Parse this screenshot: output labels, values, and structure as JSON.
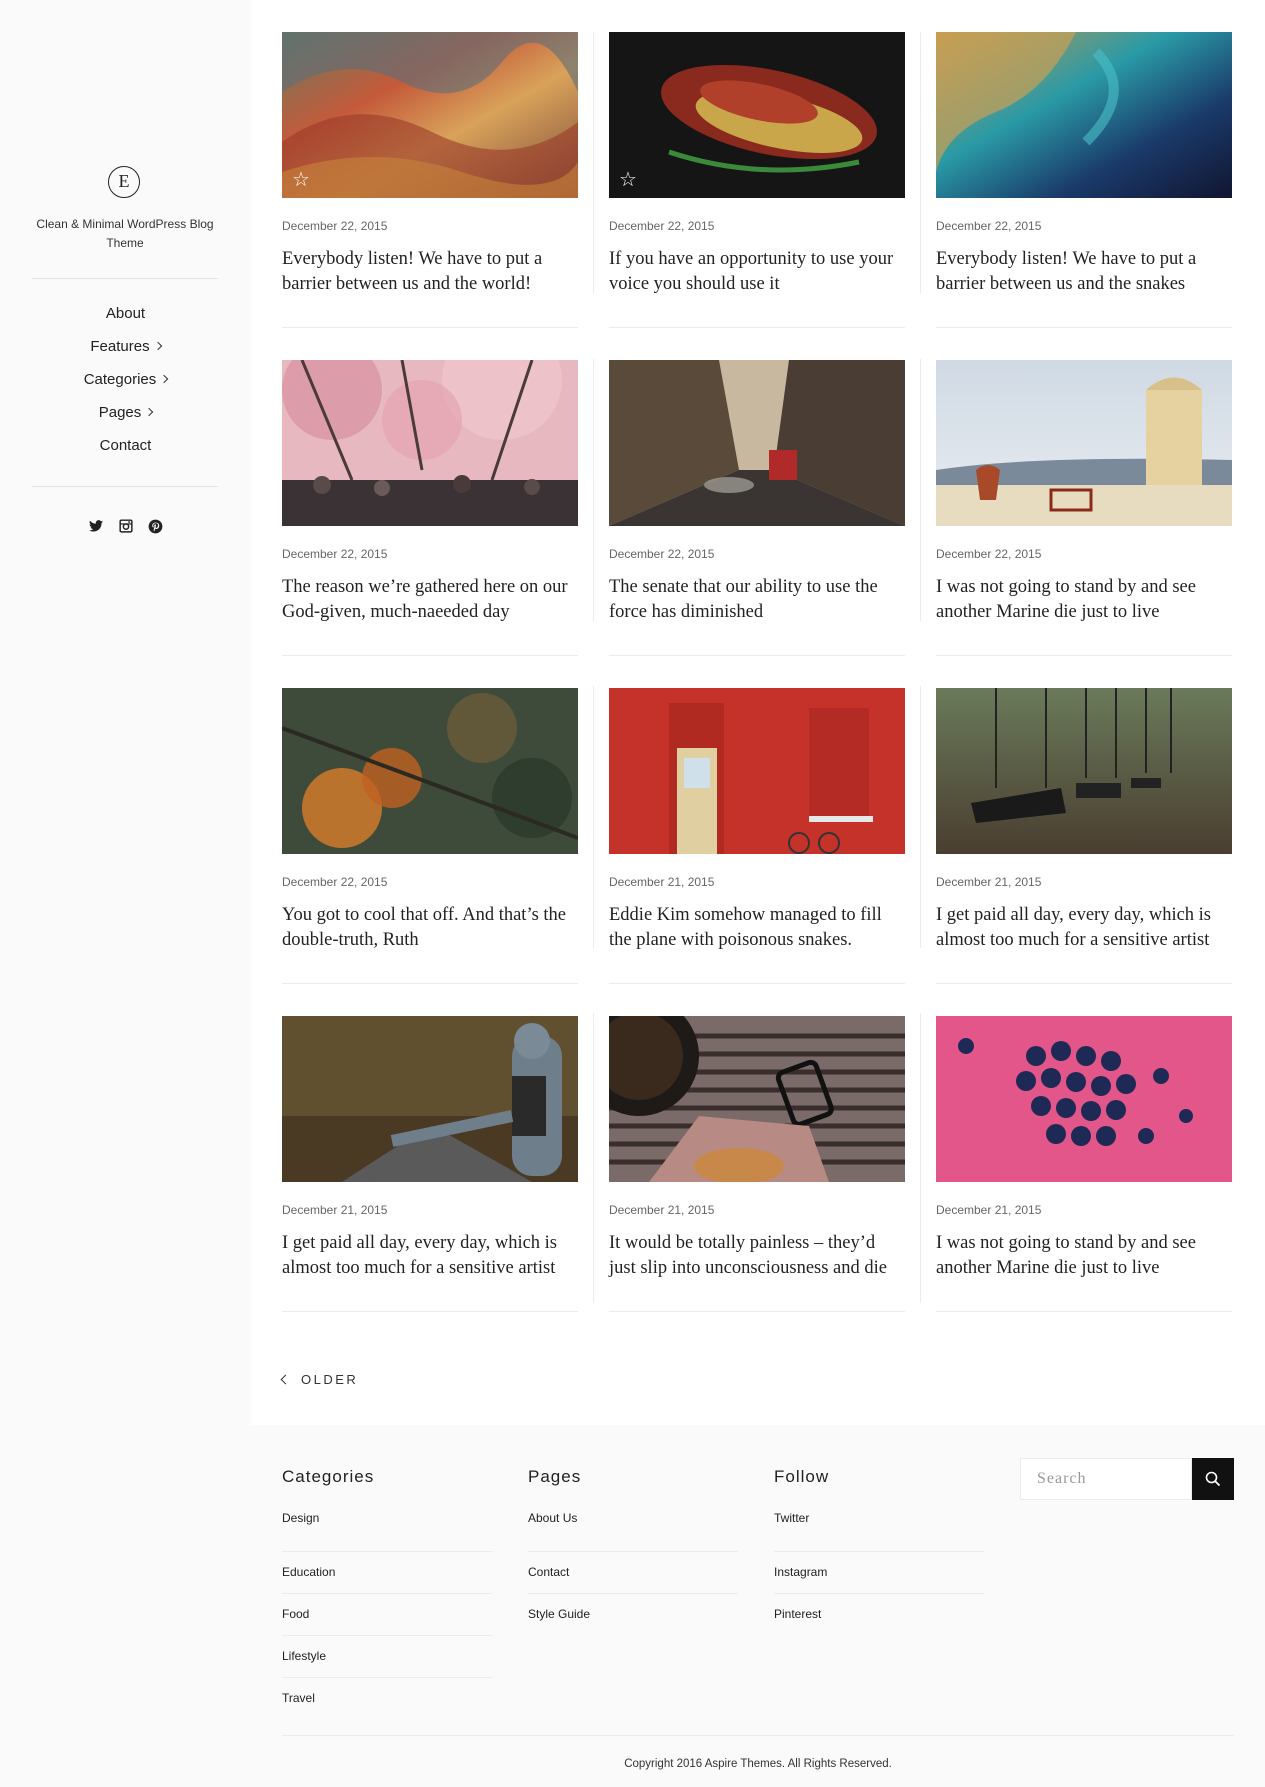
{
  "sidebar": {
    "logo_letter": "E",
    "tagline": "Clean & Minimal WordPress Blog Theme",
    "nav": [
      {
        "label": "About",
        "has_submenu": false
      },
      {
        "label": "Features",
        "has_submenu": true
      },
      {
        "label": "Categories",
        "has_submenu": true
      },
      {
        "label": "Pages",
        "has_submenu": true
      },
      {
        "label": "Contact",
        "has_submenu": false
      }
    ],
    "social_icons": [
      "twitter-icon",
      "instagram-icon",
      "pinterest-icon"
    ]
  },
  "posts": [
    {
      "date": "December 22, 2015",
      "title": "Everybody listen! We have to put a barrier between us and the world!",
      "image": "colorful-mountains",
      "featured": true
    },
    {
      "date": "December 22, 2015",
      "title": "If you have an opportunity to use your voice you should use it",
      "image": "red-leaves-dark",
      "featured": true
    },
    {
      "date": "December 22, 2015",
      "title": "Everybody listen! We have to put a barrier between us and the snakes",
      "image": "aerial-sea-coast",
      "featured": false
    },
    {
      "date": "December 22, 2015",
      "title": "The reason we’re gathered here on our God-given, much-naeeded day",
      "image": "cherry-blossom-crowd",
      "featured": false
    },
    {
      "date": "December 22, 2015",
      "title": "The senate that our ability to use the force has diminished",
      "image": "city-street",
      "featured": false
    },
    {
      "date": "December 22, 2015",
      "title": "I was not going to stand by and see another Marine die just to live",
      "image": "white-island-house",
      "featured": false
    },
    {
      "date": "December 22, 2015",
      "title": "You got to cool that off. And that’s the double-truth, Ruth",
      "image": "autumn-forest-aerial",
      "featured": false
    },
    {
      "date": "December 21, 2015",
      "title": "Eddie Kim somehow managed to fill the plane with poisonous snakes.",
      "image": "red-brick-wall-door",
      "featured": false
    },
    {
      "date": "December 21, 2015",
      "title": "I get paid all day, every day, which is almost too much for a sensitive artist",
      "image": "swings-park",
      "featured": false
    },
    {
      "date": "December 21, 2015",
      "title": "I get paid all day, every day, which is almost too much for a sensitive artist",
      "image": "hitchhiker-road",
      "featured": false
    },
    {
      "date": "December 21, 2015",
      "title": "It would be totally painless – they’d just slip into unconsciousness and die",
      "image": "coffee-glasses-cookie",
      "featured": false
    },
    {
      "date": "December 21, 2015",
      "title": "I was not going to stand by and see another Marine die just to live",
      "image": "blueberries-pink",
      "featured": false
    }
  ],
  "pagination": {
    "older_label": "OLDER"
  },
  "footer": {
    "categories": {
      "heading": "Categories",
      "items": [
        "Design",
        "Education",
        "Food",
        "Lifestyle",
        "Travel"
      ]
    },
    "pages": {
      "heading": "Pages",
      "items": [
        "About Us",
        "Contact",
        "Style Guide"
      ]
    },
    "follow": {
      "heading": "Follow",
      "items": [
        "Twitter",
        "Instagram",
        "Pinterest"
      ]
    },
    "search": {
      "placeholder": "Search"
    },
    "copyright": "Copyright 2016 Aspire Themes. All Rights Reserved."
  }
}
